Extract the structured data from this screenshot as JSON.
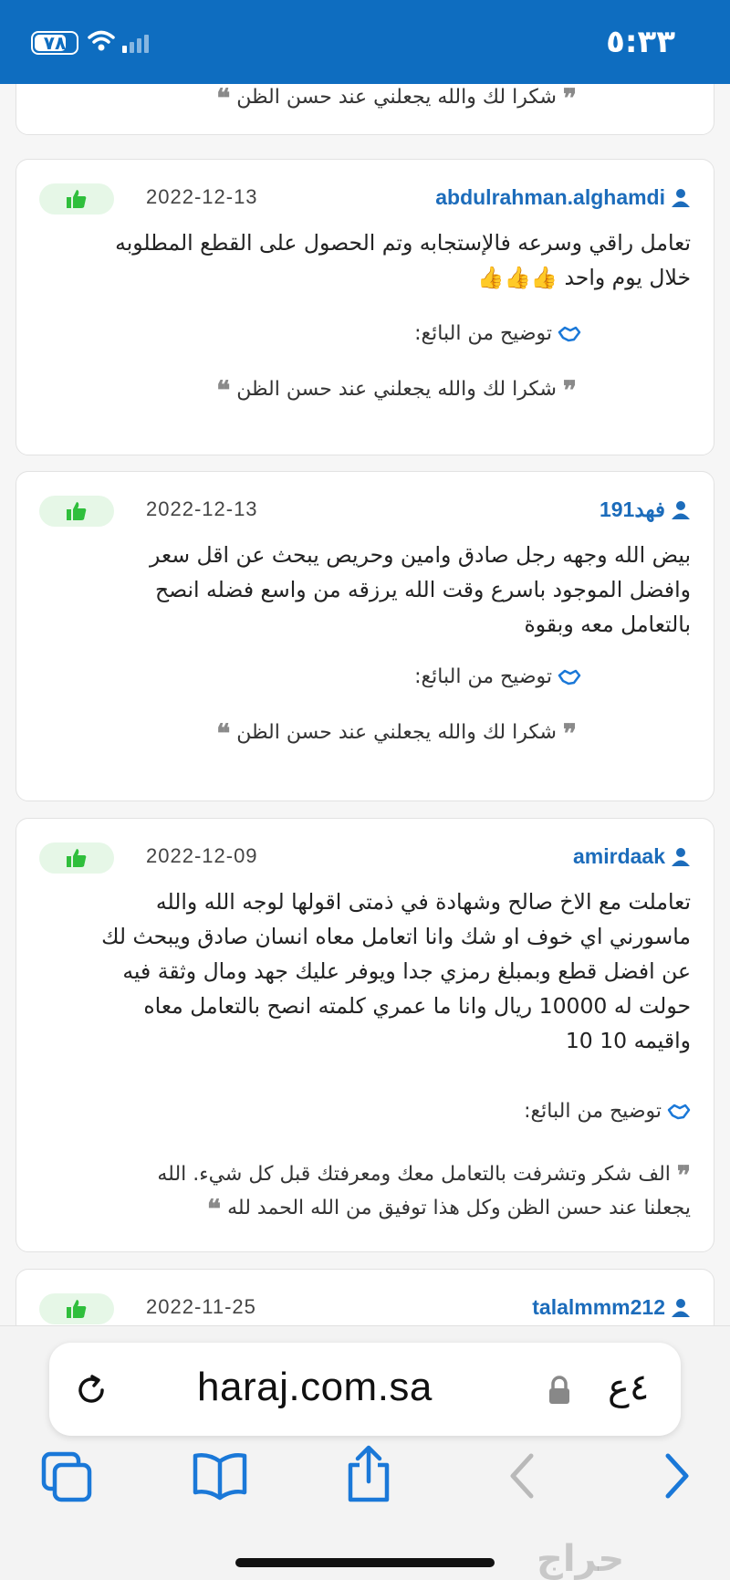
{
  "status_bar": {
    "time": "٥:٣٣",
    "battery": "٧٨"
  },
  "cards": [
    {
      "reply": "شكرا لك والله يجعلني عند حسن الظن"
    },
    {
      "username": "abdulrahman.alghamdi",
      "date": "2022-12-13",
      "review_lines": [
        "تعامل راقي وسرعه فالإستجابه وتم الحصول على القطع المطلوبه",
        "خلال يوم واحد 👍👍👍"
      ],
      "seller_label": "توضيح من البائع:",
      "reply": "شكرا لك والله يجعلني عند حسن الظن"
    },
    {
      "username": "فهد191",
      "date": "2022-12-13",
      "review_lines": [
        "بيض الله وجهه رجل صادق وامين وحريص يبحث عن اقل سعر",
        "وافضل الموجود باسرع وقت الله يرزقه من واسع فضله انصح",
        "بالتعامل معه وبقوة"
      ],
      "seller_label": "توضيح من البائع:",
      "reply": "شكرا لك والله يجعلني عند حسن الظن"
    },
    {
      "username": "amirdaak",
      "date": "2022-12-09",
      "review_lines": [
        "تعاملت مع الاخ صالح وشهادة في ذمتى اقولها لوجه الله والله",
        "ماسورني اي خوف او شك وانا اتعامل معاه انسان صادق ويبحث لك",
        "عن افضل قطع وبمبلغ رمزي جدا ويوفر عليك جهد ومال وثقة فيه",
        "حولت له 10000 ريال وانا ما عمري كلمته انصح بالتعامل معاه",
        "واقيمه 10 10"
      ],
      "seller_label": "توضيح من البائع:",
      "reply_lines": [
        "الف شكر وتشرفت بالتعامل معك ومعرفتك قبل كل شيء. الله",
        "يجعلنا عند حسن الظن وكل هذا توفيق من الله الحمد لله"
      ]
    },
    {
      "username": "talalmmm212",
      "date": "2022-11-25"
    }
  ],
  "browser": {
    "url": "haraj.com.sa",
    "text_size": "٤ع"
  },
  "watermark": "حراج",
  "colors": {
    "status_bar": "#0e6dc0",
    "username": "#1c6cbb",
    "like_bg": "#e6f7e7",
    "like_icon": "#2fbf3c",
    "toolbar_icon": "#1a78d8"
  }
}
